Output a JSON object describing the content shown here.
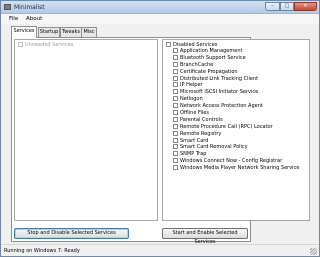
{
  "window": {
    "title": "Minimalist"
  },
  "menu": {
    "file": "File",
    "about": "About"
  },
  "tabs": [
    "Services",
    "Startup",
    "Tweaks",
    "Misc"
  ],
  "left_list": {
    "header": "Unneeded Services"
  },
  "right_list": {
    "header": "Disabled Services",
    "items": [
      "Application Management",
      "Bluetooth Support Service",
      "BranchCache",
      "Certificate Propagation",
      "Distributed Link Tracking Client",
      "IP Helper",
      "Microsoft iSCSI Initiator Service",
      "Netlogon",
      "Network Access Protection Agent",
      "Offline Files",
      "Parental Controls",
      "Remote Procedure Call (RPC) Locator",
      "Remote Registry",
      "Smart Card",
      "Smart Card Removal Policy",
      "SNMP Trap",
      "Windows Connect Now - Config Registrar",
      "Windows Media Player Network Sharing Service"
    ]
  },
  "buttons": {
    "stop_disable": "Stop and Disable Selected Services",
    "start_enable": "Start and Enable Selected Services"
  },
  "status": "Running on Windows 7: Ready",
  "icons": {
    "minimize": "–",
    "maximize": "□",
    "close": "✕"
  }
}
